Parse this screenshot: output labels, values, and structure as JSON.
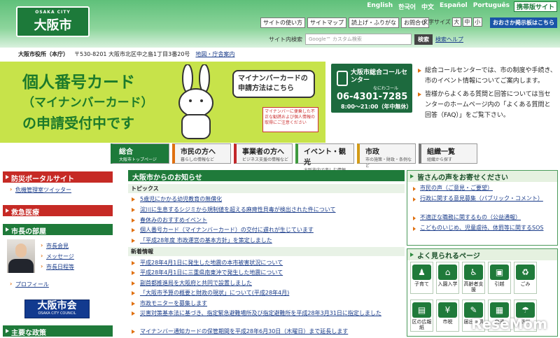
{
  "header": {
    "logo_en": "OSAKA CITY",
    "logo_jp": "大阪市",
    "languages": [
      "English",
      "한국어",
      "中文",
      "Español",
      "Português"
    ],
    "mobile": "携帯版サイト",
    "tools": [
      "サイトの使い方",
      "サイトマップ",
      "読上げ・ふりがな",
      "お問合せ"
    ],
    "font_size_label": "文字サイズ",
    "font_sizes": [
      "大",
      "中",
      "小"
    ],
    "odekake": "おおさか掲示板はこちら",
    "search_label": "サイト内検索",
    "search_placeholder": "Google™ カスタム検索",
    "search_button": "検索",
    "search_help": "検索ヘルプ"
  },
  "address": {
    "office": "大阪市役所（本庁）",
    "detail": "〒530-8201 大阪市北区中之島1丁目3番20号",
    "map": "地図・庁舎案内"
  },
  "banner": {
    "line1": "個人番号カード",
    "line2": "（マイナンバーカード）",
    "line3": "の申請受付中です",
    "bubble": "マイナンバーカードの申請方法はこちら",
    "warn": "マイナンバーに便乗した不正な勧誘および個人情報の取得にご注意ください"
  },
  "callcenter": {
    "title": "大阪市総合コールセンター",
    "reading": "なにわコール",
    "number": "06-4301-7285",
    "hours": "8:00～21:00（年中無休）"
  },
  "callinfo": [
    "総合コールセンターでは、市の制度や手続き、市のイベント情報についてご案内します。",
    "皆様からよくある質問と回答については当センターのホームページ内の「よくある質問と回答（FAQ）」をご覧下さい。"
  ],
  "gnav": [
    {
      "title": "総合",
      "sub": "大阪市トップページ"
    },
    {
      "title": "市民の方へ",
      "sub": "暮らしの情報など"
    },
    {
      "title": "事業者の方へ",
      "sub": "ビジネス支援の情報など"
    },
    {
      "title": "イベント・観光",
      "sub": "大阪市内で楽しむ情報"
    },
    {
      "title": "市政",
      "sub": "市の施策・財政・条例など"
    },
    {
      "title": "組織一覧",
      "sub": "組織から探す"
    }
  ],
  "left": {
    "bousai": "防災ポータルサイト",
    "twitter": "危機管理室ツイッター",
    "kyukyu": "救急医療",
    "mayor_title": "市長の部屋",
    "mayor_links": [
      "市長会見",
      "メッセージ",
      "市長日程等"
    ],
    "profile": "プロフィール",
    "council_jp": "大阪市会",
    "council_en": "OSAKA CITY COUNCIL",
    "policy": "主要な政策"
  },
  "main": {
    "title": "大阪市からのお知らせ",
    "topics_label": "トピックス",
    "topics": [
      "5歳児にかかる幼児教育の無償化",
      "淀川に生息するシジミから規制値を超える麻痺性貝毒が検出された件について",
      "春休みのおすすめイベント",
      "個人番号カード（マイナンバーカード）の交付に遅れが生じています",
      "「平成28年度 市政運営の基本方針」を策定しました"
    ],
    "new_label": "新着情報",
    "news": [
      "平成28年4月1日に発生した地震の本市被害状況について",
      "平成28年4月1日に三重県南東沖で発生した地震について",
      "副首都推進局を大阪府と共同で設置しました",
      "「大阪市予算の概要と財政の現状」について(平成28年4月)",
      "市政モニターを募集します",
      "災害対策基本法に基づき、指定緊急避難場所及び指定避難所を平成28年3月31日に指定しました",
      "マイナンバー通知カードの保管期間を平成28年6月30日（木曜日）まで延長します"
    ]
  },
  "right": {
    "voice_title": "皆さんの声をお寄せください",
    "voice_links": [
      "市民の声（ご意見・ご要望）",
      "行政に関する意見募集（パブリック・コメント）",
      "不適正な職務に関するもの（公益通報）",
      "こどものいじめ、児童虐待、体罰等に関するSOS"
    ],
    "pop_title": "よく見られるページ",
    "icons": [
      "子育て",
      "入園入学",
      "高齢者支援",
      "引越",
      "ごみ",
      "区の広報紙",
      "市税",
      "届出証明",
      "交通",
      "防災"
    ],
    "watermark": "ReseMom"
  }
}
